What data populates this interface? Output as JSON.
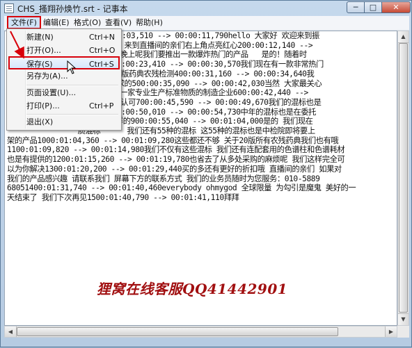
{
  "window": {
    "title": "CHS_搔翔孙焕竹.srt - 记事本",
    "min_label": "─",
    "max_label": "□",
    "close_label": "✕"
  },
  "menubar": {
    "items": [
      {
        "label": "文件(F)"
      },
      {
        "label": "编辑(E)"
      },
      {
        "label": "格式(O)"
      },
      {
        "label": "查看(V)"
      },
      {
        "label": "帮助(H)"
      }
    ]
  },
  "file_menu": {
    "items": [
      {
        "label": "新建(N)",
        "shortcut": "Ctrl+N"
      },
      {
        "label": "打开(O)...",
        "shortcut": "Ctrl+O"
      },
      {
        "label": "保存(S)",
        "shortcut": "Ctrl+S"
      },
      {
        "label": "另存为(A)...",
        "shortcut": ""
      },
      {
        "label": "页面设置(U)...",
        "shortcut": ""
      },
      {
        "label": "打印(P)...",
        "shortcut": "Ctrl+P"
      },
      {
        "label": "退出(X)",
        "shortcut": ""
      }
    ]
  },
  "editor": {
    "lines": [
      "               3,100100:00:03,510 --> 00:00:11,790hello 大家好 欢迎来到振",
      "                了 我是小孙 来到直播间的亲们右上角点亮红心200:00:12,140 -->",
      "                抽奖哦 今天晚上呢我们要推出一款爆炸热门的产品   是的！随着时",
      "                年新变化300:00:23,410 --> 00:00:30,570我们现在有一款非常热门",
      "                道 那就是20版药典农残检测400:00:31,160 --> 00:00:34,640我",
      "                20版药典要求的500:00:35,090 --> 00:00:42,030当然 大家最关心",
      "                心的 我们是一家专业生产标准物质的制造企业600:00:42,440 -->",
      "                NAS17034的认可700:00:45,590 --> 00:00:49,670我们的混标也是",
      "                采购项目800:00:50,010 --> 00:00:54,730中年的混标也是在委托",
      "                和中检院一样的900:00:55,040 --> 00:01:04,000是的 我们现在",
      "                质混标      我们还有55种的混标 这55种的混标也是中检院即将要上",
      "架的产品1000:01:04,360 --> 00:01:09,280这些都还不够 关于20版所有农残药典我们也有哦",
      "1100:01:09,820 --> 00:01:14,980我们不仅有这些混标 我们还有连配套用的色谱柱和色谱耗材",
      "也是有提供的1200:01:15,260 --> 00:01:19,780也省去了从多处采购的麻烦呢 我们这样完全可",
      "以为你解决1300:01:20,200 --> 00:01:29,440买的多还有更好的折扣哦 直播间的亲们 如果对",
      "我们的产品感兴趣 请联系我们 屏幕下方的联系方式 我们的业务员随时为您服务：010-5889",
      "68051400:01:31,740 --> 00:01:40,460everybody ohmygod 全球限量 为勾引是魔鬼 美好的一",
      "天结束了 我们下次再见1500:01:40,790 --> 00:01:41,110拜拜"
    ]
  },
  "watermark": "狸窝在线客服QQ41442901",
  "scrollbar": {
    "up": "▲",
    "down": "▼",
    "left": "◀",
    "right": "▶"
  }
}
